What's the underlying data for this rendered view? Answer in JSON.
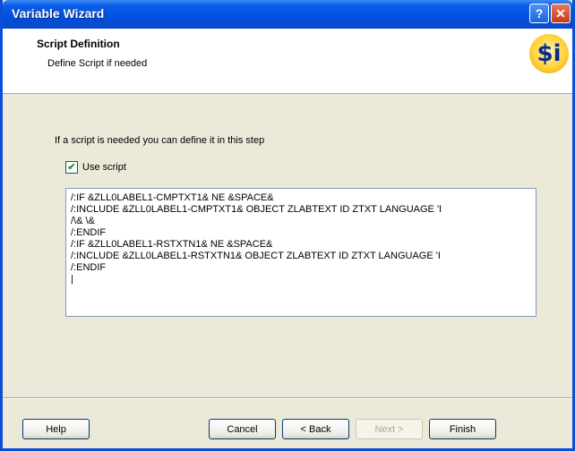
{
  "window": {
    "title": "Variable Wizard",
    "help_glyph": "?",
    "close_glyph": "✕"
  },
  "header": {
    "title": "Script Definition",
    "subtitle": "Define Script if needed",
    "logo_text": "$i"
  },
  "content": {
    "instruction": "If a script is needed you can define it in this step",
    "use_script": {
      "label": "Use script",
      "checked": true,
      "check_glyph": "✔"
    },
    "script_lines": [
      "/:IF &ZLL0LABEL1-CMPTXT1& NE &SPACE&",
      "/:INCLUDE &ZLL0LABEL1-CMPTXT1& OBJECT ZLABTEXT ID ZTXT LANGUAGE 'I",
      "/\\& \\&",
      "/:ENDIF",
      "/:IF &ZLL0LABEL1-RSTXTN1& NE &SPACE&",
      "/:INCLUDE &ZLL0LABEL1-RSTXTN1& OBJECT ZLABTEXT ID ZTXT LANGUAGE 'I",
      "/:ENDIF"
    ]
  },
  "buttons": {
    "help": "Help",
    "cancel": "Cancel",
    "back": "< Back",
    "next": "Next >",
    "finish": "Finish"
  }
}
